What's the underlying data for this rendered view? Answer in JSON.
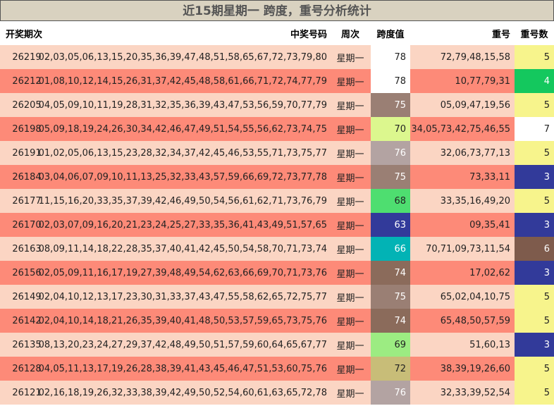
{
  "title": "近15期星期一 跨度，重号分析统计",
  "headers": {
    "period": "开奖期次",
    "numbers": "中奖号码",
    "weekday": "周次",
    "span": "跨度值",
    "repeat": "重号",
    "count": "重号数"
  },
  "colors": {
    "row_light": "#fbd5c3",
    "row_dark": "#fd8a78",
    "title_bg": "#d9d2c0"
  },
  "rows": [
    {
      "period": "26219",
      "numbers": "02,03,05,06,13,15,20,35,36,39,47,48,51,58,65,67,72,73,79,80",
      "weekday": "星期一",
      "span": "78",
      "span_color": "#ffffff",
      "repeat": "72,79,48,15,58",
      "count": "5",
      "count_color": "#f7f48c"
    },
    {
      "period": "26212",
      "numbers": "01,08,10,12,14,15,26,31,37,42,45,48,58,61,66,71,72,74,77,79",
      "weekday": "星期一",
      "span": "78",
      "span_color": "#ffffff",
      "repeat": "10,77,79,31",
      "count": "4",
      "count_color": "#14c85e"
    },
    {
      "period": "26205",
      "numbers": "04,05,09,10,11,19,28,31,32,35,36,39,43,47,53,56,59,70,77,79",
      "weekday": "星期一",
      "span": "75",
      "span_color": "#9a7f74",
      "repeat": "05,09,47,19,56",
      "count": "5",
      "count_color": "#f7f48c"
    },
    {
      "period": "26198",
      "numbers": "05,09,18,19,24,26,30,34,42,46,47,49,51,54,55,56,62,73,74,75",
      "weekday": "星期一",
      "span": "70",
      "span_color": "#dcf78e",
      "repeat": "34,05,73,42,75,46,55",
      "count": "7",
      "count_color": "#ffffff"
    },
    {
      "period": "26191",
      "numbers": "01,02,05,06,13,15,23,28,32,34,37,42,45,46,53,55,71,73,75,77",
      "weekday": "星期一",
      "span": "76",
      "span_color": "#b3a3a2",
      "repeat": "32,06,73,77,13",
      "count": "5",
      "count_color": "#f7f48c"
    },
    {
      "period": "26184",
      "numbers": "03,04,06,07,09,10,11,13,25,32,33,43,57,59,66,69,72,73,77,78",
      "weekday": "星期一",
      "span": "75",
      "span_color": "#9a7f74",
      "repeat": "73,33,11",
      "count": "3",
      "count_color": "#323a9a"
    },
    {
      "period": "26177",
      "numbers": "11,15,16,20,33,35,37,39,42,46,49,50,54,56,61,62,71,73,76,79",
      "weekday": "星期一",
      "span": "68",
      "span_color": "#4ede70",
      "repeat": "33,35,16,49,20",
      "count": "5",
      "count_color": "#f7f48c"
    },
    {
      "period": "26170",
      "numbers": "02,03,07,09,16,20,21,23,24,25,27,33,35,36,41,43,49,51,57,65",
      "weekday": "星期一",
      "span": "63",
      "span_color": "#323a9a",
      "repeat": "09,35,41",
      "count": "3",
      "count_color": "#323a9a"
    },
    {
      "period": "26163",
      "numbers": "08,09,11,14,18,22,28,35,37,40,41,42,45,50,54,58,70,71,73,74",
      "weekday": "星期一",
      "span": "66",
      "span_color": "#02b3b5",
      "repeat": "70,71,09,73,11,54",
      "count": "6",
      "count_color": "#7e5b4c"
    },
    {
      "period": "26156",
      "numbers": "02,05,09,11,16,17,19,27,39,48,49,54,62,63,66,69,70,71,73,76",
      "weekday": "星期一",
      "span": "74",
      "span_color": "#8b6b5b",
      "repeat": "17,02,62",
      "count": "3",
      "count_color": "#323a9a"
    },
    {
      "period": "26149",
      "numbers": "02,04,10,12,13,17,23,30,31,33,37,43,47,55,58,62,65,72,75,77",
      "weekday": "星期一",
      "span": "75",
      "span_color": "#9a7f74",
      "repeat": "65,02,04,10,75",
      "count": "5",
      "count_color": "#f7f48c"
    },
    {
      "period": "26142",
      "numbers": "02,04,10,14,18,21,26,35,39,40,41,48,50,53,57,59,65,73,75,76",
      "weekday": "星期一",
      "span": "74",
      "span_color": "#8b6b5b",
      "repeat": "65,48,50,57,59",
      "count": "5",
      "count_color": "#f7f48c"
    },
    {
      "period": "26135",
      "numbers": "08,13,20,23,24,27,29,37,42,48,49,50,51,57,59,60,64,65,67,77",
      "weekday": "星期一",
      "span": "69",
      "span_color": "#9cec82",
      "repeat": "51,60,13",
      "count": "3",
      "count_color": "#323a9a"
    },
    {
      "period": "26128",
      "numbers": "04,05,11,13,17,19,26,28,38,39,41,43,45,46,47,51,53,60,75,76",
      "weekday": "星期一",
      "span": "72",
      "span_color": "#c8bd78",
      "repeat": "38,39,19,26,60",
      "count": "5",
      "count_color": "#f7f48c"
    },
    {
      "period": "26121",
      "numbers": "02,16,18,19,26,32,33,38,39,42,49,50,52,54,60,61,63,65,72,78",
      "weekday": "星期一",
      "span": "76",
      "span_color": "#b3a3a2",
      "repeat": "32,33,39,52,54",
      "count": "5",
      "count_color": "#f7f48c"
    }
  ]
}
